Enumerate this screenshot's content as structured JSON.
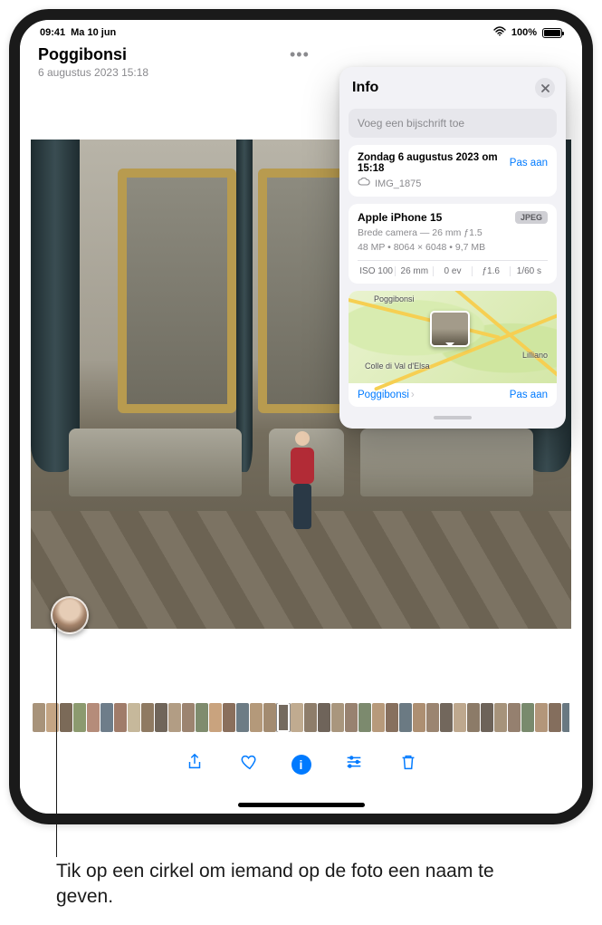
{
  "status": {
    "time": "09:41",
    "date": "Ma 10 jun",
    "battery_pct": "100%"
  },
  "header": {
    "title": "Poggibonsi",
    "subtitle": "6 augustus 2023 15:18"
  },
  "popover": {
    "title": "Info",
    "caption_placeholder": "Voeg een bijschrift toe",
    "date_line": "Zondag 6 augustus 2023 om 15:18",
    "adjust_label": "Pas aan",
    "filename": "IMG_1875",
    "device": "Apple iPhone 15",
    "format_tag": "JPEG",
    "lens": "Brede camera — 26 mm ƒ1.5",
    "megapixels": "48 MP",
    "dimensions": "8064 × 6048",
    "filesize": "9,7 MB",
    "exif": {
      "iso": "ISO 100",
      "focal": "26 mm",
      "ev": "0 ev",
      "aperture": "ƒ1.6",
      "shutter": "1/60 s"
    },
    "map": {
      "place1": "Poggibonsi",
      "place2": "Colle di Val d'Elsa",
      "place3": "Lilliano",
      "link_label": "Poggibonsi",
      "adjust_label": "Pas aan"
    }
  },
  "thumbs": [
    "#a8937a",
    "#c4a584",
    "#7b6a58",
    "#8c9a6f",
    "#b58c7a",
    "#6e7d8a",
    "#a07c6a",
    "#c6b89b",
    "#8f7a62",
    "#70655a",
    "#b29d84",
    "#9c8470",
    "#7f8c6e",
    "#c9a37e",
    "#8a6f5c",
    "#6d7c85",
    "#b4997a",
    "#a38b70",
    "#746a5e",
    "#c0ab90",
    "#8e7d6a",
    "#6f645a",
    "#a9967d",
    "#988270",
    "#7c8a6e",
    "#b79a7b",
    "#87705e",
    "#6b7a83",
    "#ad8f72",
    "#9b8571",
    "#72675c",
    "#bea88e",
    "#8c7b68",
    "#6d6359",
    "#a6937b",
    "#95806f",
    "#798a6d",
    "#b3967a",
    "#846e5d",
    "#697881",
    "#ab8d71"
  ],
  "thumb_selected_index": 18,
  "toolbar": {
    "share": "share",
    "favorite": "favorite",
    "info": "i",
    "edit": "edit",
    "trash": "trash"
  },
  "callout": "Tik op een cirkel om iemand op de foto een naam te geven."
}
